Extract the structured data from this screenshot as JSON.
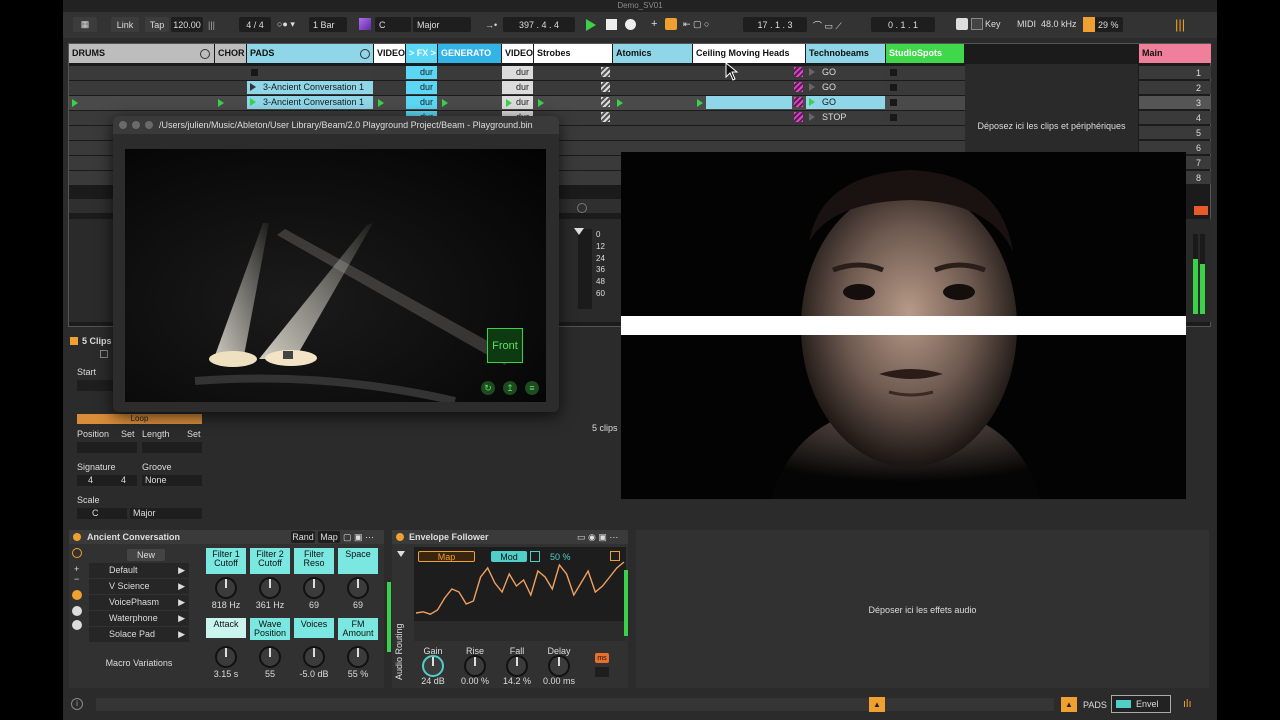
{
  "window": {
    "title": "Demo_SV01"
  },
  "toolbar": {
    "link": "Link",
    "tap": "Tap",
    "tempo": "120.00",
    "signature": "4 / 4",
    "quantize": "1 Bar",
    "key_root": "C",
    "scale": "Major",
    "position": "397 .  4 .  4",
    "loop_start": "17 .  1 .  3",
    "loop_length": "0 .  1 .  1",
    "key_label": "Key",
    "midi_label": "MIDI",
    "sample_rate": "48.0 kHz",
    "cpu": "29 %"
  },
  "tracks": [
    {
      "name": "DRUMS",
      "color": "#bdbdbd"
    },
    {
      "name": "CHOR",
      "color": "#bdbdbd"
    },
    {
      "name": "PADS",
      "color": "#8ed6e8"
    },
    {
      "name": "VIDEO",
      "color": "#ffffff"
    },
    {
      "name": "> FX >",
      "color": "#5bd7f5"
    },
    {
      "name": "GENERATO",
      "color": "#32b4e6"
    },
    {
      "name": "VIDEO",
      "color": "#ffffff"
    },
    {
      "name": "Strobes",
      "color": "#ffffff"
    },
    {
      "name": "Atomics",
      "color": "#8ed6e8"
    },
    {
      "name": "Ceiling Moving Heads",
      "color": "#ffffff"
    },
    {
      "name": "Technobeams",
      "color": "#8ed6e8"
    },
    {
      "name": "StudioSpots",
      "color": "#3fd84a"
    }
  ],
  "clips": {
    "pads_1": "3-Ancient Conversation 1",
    "pads_2": "3-Ancient Conversation 1",
    "dur": "dur",
    "go": "GO",
    "stop": "STOP"
  },
  "master": {
    "name": "Main",
    "scenes": [
      "1",
      "2",
      "3",
      "4",
      "5",
      "6",
      "7",
      "8"
    ]
  },
  "drop_clips": "Déposez ici les clips et périphériques",
  "meter_scale": [
    "0",
    "12",
    "24",
    "36",
    "48",
    "60"
  ],
  "beam_window": {
    "title": "/Users/julien/Music/Ableton/User Library/Beam/2.0 Playground Project/Beam - Playground.bin",
    "front_label": "Front"
  },
  "clip_panel": {
    "header": "5 Clips",
    "start": "Start",
    "loop": "Loop",
    "position": "Position",
    "set": "Set",
    "length": "Length",
    "signature": "Signature",
    "groove": "Groove",
    "sig_num": "4",
    "sig_den": "4",
    "groove_value": "None",
    "scale": "Scale",
    "scale_root": "C",
    "scale_name": "Major",
    "status": "5 clips"
  },
  "rack": {
    "title": "Ancient Conversation",
    "rand": "Rand",
    "map": "Map",
    "new": "New",
    "presets": [
      "Default",
      "V Science",
      "VoicePhasm",
      "Waterphone",
      "Solace Pad"
    ],
    "macro_variations": "Macro Variations",
    "macros": [
      {
        "label": "Filter 1 Cutoff",
        "value": "818 Hz"
      },
      {
        "label": "Filter 2 Cutoff",
        "value": "361 Hz"
      },
      {
        "label": "Filter Reso",
        "value": "69"
      },
      {
        "label": "Space",
        "value": "69"
      },
      {
        "label": "Attack",
        "value": "3.15 s"
      },
      {
        "label": "Wave Position",
        "value": "55"
      },
      {
        "label": "Voices",
        "value": "-5.0 dB"
      },
      {
        "label": "FM Amount",
        "value": "55 %"
      }
    ]
  },
  "envelope": {
    "title": "Envelope Follower",
    "map": "Map",
    "mod": "Mod",
    "amount": "50 %",
    "audio_routing": "Audio Routing",
    "params": [
      {
        "label": "Gain",
        "value": "24 dB"
      },
      {
        "label": "Rise",
        "value": "0.00 %"
      },
      {
        "label": "Fall",
        "value": "14.2 %"
      },
      {
        "label": "Delay",
        "value": "0.00 ms"
      }
    ],
    "unit": "ms",
    "curve": [
      0.1,
      0.12,
      0.08,
      0.15,
      0.35,
      0.5,
      0.45,
      0.25,
      0.3,
      0.7,
      0.85,
      0.6,
      0.45,
      0.75,
      0.55,
      0.65,
      0.4,
      0.8,
      0.7,
      0.5,
      0.9,
      0.75,
      0.4,
      0.6,
      0.8,
      0.45,
      0.55,
      0.7,
      0.85,
      0.95
    ]
  },
  "drop_audio": "Déposer ici les effets audio",
  "bottom": {
    "pads": "PADS",
    "envel": "Envel"
  }
}
